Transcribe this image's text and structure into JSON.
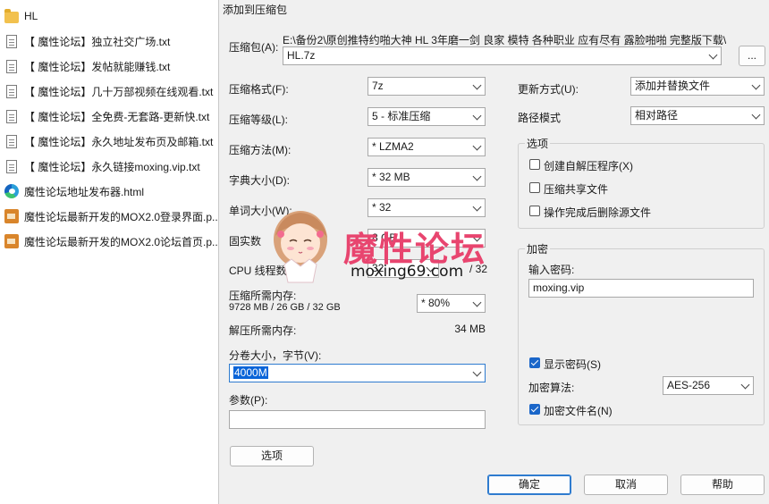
{
  "explorer": {
    "items": [
      {
        "label": "HL",
        "icon": "folder-icon"
      },
      {
        "label": "【 魔性论坛】独立社交广场.txt",
        "icon": "text-file-icon"
      },
      {
        "label": "【 魔性论坛】发帖就能赚钱.txt",
        "icon": "text-file-icon"
      },
      {
        "label": "【 魔性论坛】几十万部视频在线观看.txt",
        "icon": "text-file-icon"
      },
      {
        "label": "【 魔性论坛】全免费-无套路-更新快.txt",
        "icon": "text-file-icon"
      },
      {
        "label": "【 魔性论坛】永久地址发布页及邮箱.txt",
        "icon": "text-file-icon"
      },
      {
        "label": "【 魔性论坛】永久链接moxing.vip.txt",
        "icon": "text-file-icon"
      },
      {
        "label": "魔性论坛地址发布器.html",
        "icon": "edge-html-icon"
      },
      {
        "label": "魔性论坛最新开发的MOX2.0登录界面.p...",
        "icon": "image-file-icon"
      },
      {
        "label": "魔性论坛最新开发的MOX2.0论坛首页.p...",
        "icon": "image-file-icon"
      }
    ]
  },
  "dialog": {
    "title": "添加到压缩包",
    "archive_label": "压缩包(A):",
    "archive_path": "E:\\备份2\\原创推特约啪大神 HL 3年磨一剑 良家 模特 各种职业 应有尽有 露脸啪啪 完整版下载\\",
    "archive_name": "HL.7z",
    "browse_label": "...",
    "format_label": "压缩格式(F):",
    "format_value": "7z",
    "level_label": "压缩等级(L):",
    "level_value": "5 - 标准压缩",
    "method_label": "压缩方法(M):",
    "method_value": "* LZMA2",
    "dict_label": "字典大小(D):",
    "dict_value": "* 32 MB",
    "word_label": "单词大小(W):",
    "word_value": "* 32",
    "solid_label": "固实数",
    "solid_value": "8 GB",
    "cpu_label": "CPU 线程数",
    "cpu_value": "32",
    "cpu_total": "/ 32",
    "mem_label": "压缩所需内存:",
    "mem_detail": "9728 MB / 26 GB / 32 GB",
    "mem_value": "* 80%",
    "decomp_label": "解压所需内存:",
    "decomp_value": "34 MB",
    "volume_label": "分卷大小，字节(V):",
    "volume_value": "4000M",
    "params_label": "参数(P):",
    "params_value": "",
    "options_button": "选项",
    "update_label": "更新方式(U):",
    "update_value": "添加并替换文件",
    "path_label": "路径模式",
    "path_value": "相对路径",
    "options_group": "选项",
    "opt_sfx": "创建自解压程序(X)",
    "opt_shared": "压缩共享文件",
    "opt_delete": "操作完成后删除源文件",
    "enc_group": "加密",
    "password_label": "输入密码:",
    "password_value": "moxing.vip",
    "show_password": "显示密码(S)",
    "enc_method_label": "加密算法:",
    "enc_method_value": "AES-256",
    "enc_names": "加密文件名(N)",
    "ok": "确定",
    "cancel": "取消",
    "help": "帮助"
  },
  "watermark": {
    "title": "魔性论坛",
    "url": "moxing69.com"
  },
  "colors": {
    "accent": "#1a66c9",
    "watermark_pink": "#e8456f"
  }
}
